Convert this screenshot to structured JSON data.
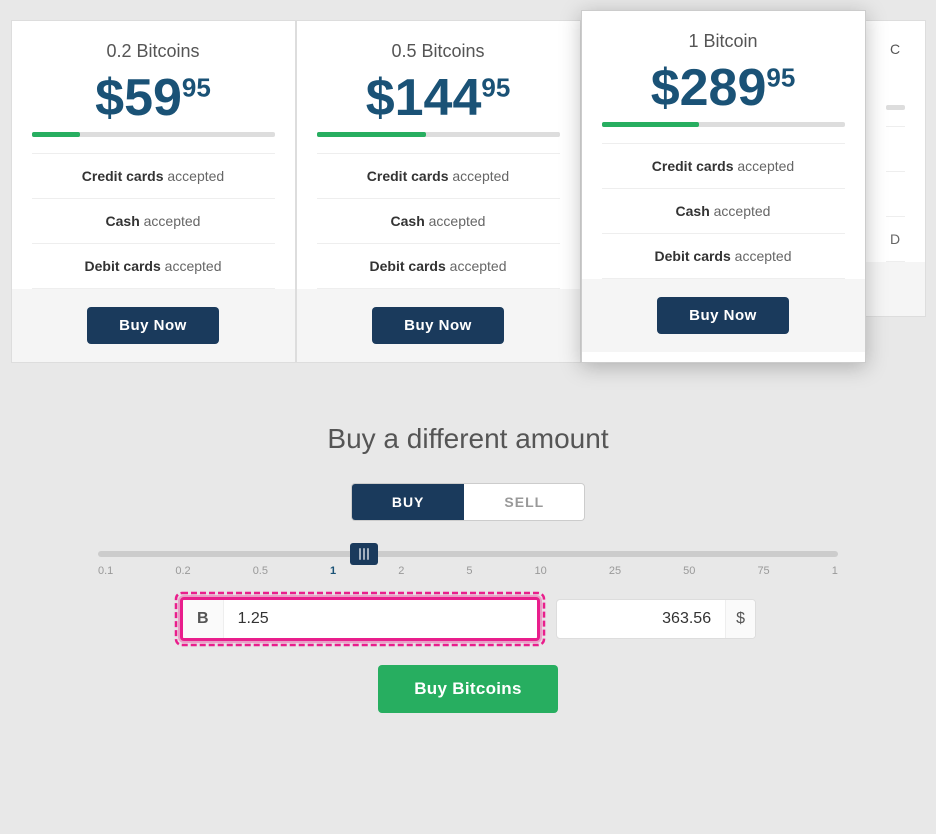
{
  "cards": [
    {
      "id": "card-02",
      "title": "0.2 Bitcoins",
      "price_main": "$59",
      "price_cents": "95",
      "progress_pct": 20,
      "features": [
        {
          "label": "Credit cards",
          "suffix": "accepted"
        },
        {
          "label": "Cash",
          "suffix": "accepted"
        },
        {
          "label": "Debit cards",
          "suffix": "accepted"
        }
      ],
      "buy_label": "Buy Now",
      "featured": false
    },
    {
      "id": "card-05",
      "title": "0.5 Bitcoins",
      "price_main": "$144",
      "price_cents": "95",
      "progress_pct": 45,
      "features": [
        {
          "label": "Credit cards",
          "suffix": "accepted"
        },
        {
          "label": "Cash",
          "suffix": "accepted"
        },
        {
          "label": "Debit cards",
          "suffix": "accepted"
        }
      ],
      "buy_label": "Buy Now",
      "featured": false
    },
    {
      "id": "card-1",
      "title": "1 Bitcoin",
      "price_main": "$289",
      "price_cents": "95",
      "progress_pct": 40,
      "features": [
        {
          "label": "Credit cards",
          "suffix": "accepted"
        },
        {
          "label": "Cash",
          "suffix": "accepted"
        },
        {
          "label": "Debit cards",
          "suffix": "accepted"
        }
      ],
      "buy_label": "Buy Now",
      "featured": true
    }
  ],
  "partial_card": {
    "title": "C",
    "feature1": "D"
  },
  "custom_section": {
    "title": "Buy a different amount",
    "toggle": {
      "buy_label": "BUY",
      "sell_label": "SELL"
    },
    "slider": {
      "labels": [
        "0.1",
        "0.2",
        "0.5",
        "1",
        "2",
        "5",
        "10",
        "25",
        "50",
        "75",
        "1"
      ],
      "active_label_index": 3,
      "thumb_position_pct": 36
    },
    "bitcoin_input": {
      "prefix": "B",
      "value": "1.25",
      "placeholder": ""
    },
    "usd_input": {
      "value": "363.56",
      "suffix": "$"
    },
    "buy_button_label": "Buy Bitcoins"
  }
}
